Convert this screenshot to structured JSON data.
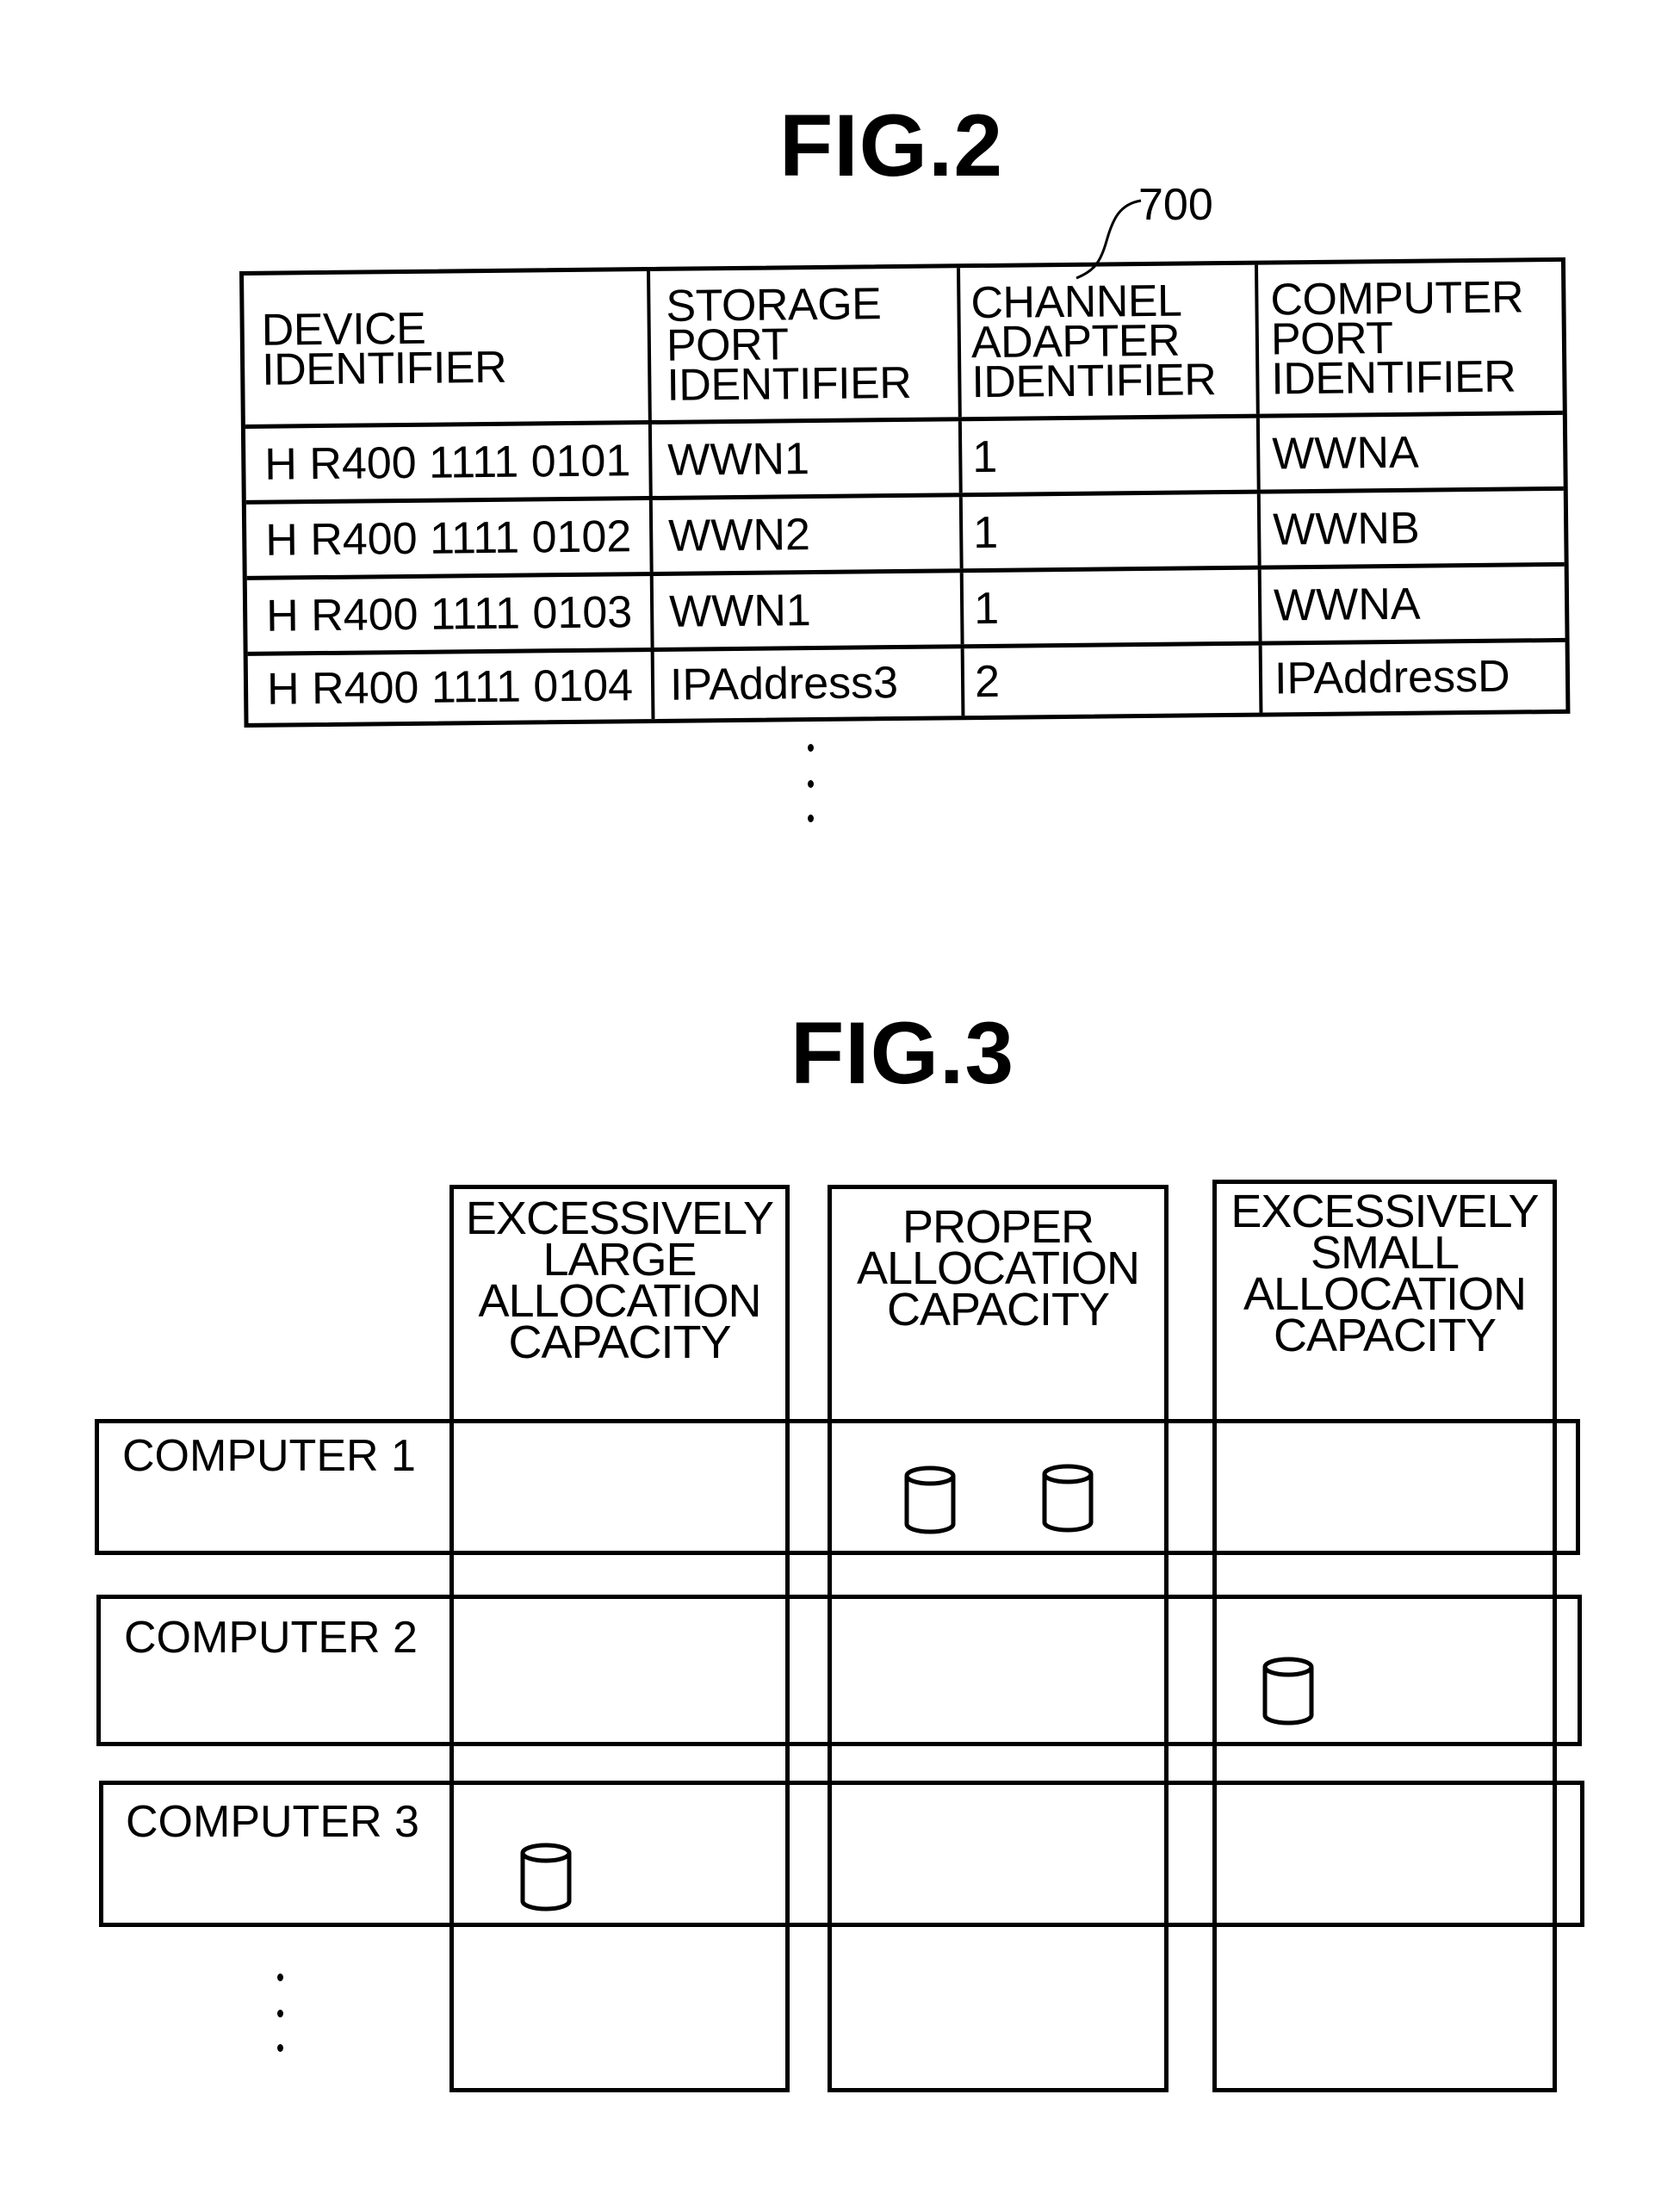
{
  "fig2": {
    "title": "FIG.2",
    "reference_label": "700",
    "headers": [
      "DEVICE\nIDENTIFIER",
      "STORAGE\nPORT\nIDENTIFIER",
      "CHANNEL\nADAPTER\nIDENTIFIER",
      "COMPUTER\nPORT\nIDENTIFIER"
    ],
    "rows": [
      [
        "H R400 1111 0101",
        "WWN1",
        "1",
        "WWNA"
      ],
      [
        "H R400 1111 0102",
        "WWN2",
        "1",
        "WWNB"
      ],
      [
        "H R400 1111 0103",
        "WWN1",
        "1",
        "WWNA"
      ],
      [
        "H R400 1111 0104",
        "IPAddress3",
        "2",
        "IPAddressD"
      ]
    ],
    "continuation": "⋮"
  },
  "fig3": {
    "title": "FIG.3",
    "columns": [
      "EXCESSIVELY\nLARGE\nALLOCATION\nCAPACITY",
      "PROPER\nALLOCATION\nCAPACITY",
      "EXCESSIVELY\nSMALL\nALLOCATION\nCAPACITY"
    ],
    "rows": [
      {
        "label": "COMPUTER 1",
        "volumes": [
          0,
          2,
          0
        ]
      },
      {
        "label": "COMPUTER 2",
        "volumes": [
          0,
          0,
          1
        ]
      },
      {
        "label": "COMPUTER 3",
        "volumes": [
          1,
          0,
          0
        ]
      }
    ],
    "volume_icon": "cylinder-disk-icon",
    "continuation": "⋮"
  }
}
